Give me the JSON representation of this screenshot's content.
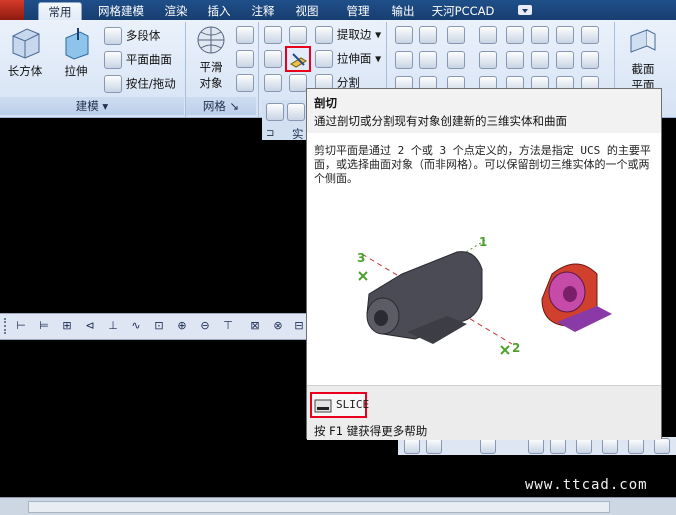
{
  "tabs": [
    "常用",
    "网格建模",
    "渲染",
    "插入",
    "注释",
    "视图",
    "管理",
    "输出",
    "天河PCCAD"
  ],
  "active_tab": "常用",
  "ribbon": {
    "modeling": {
      "box_label": "长方体",
      "extrude_label": "拉伸",
      "polysolid_label": "多段体",
      "planar_label": "平面曲面",
      "presspull_label": "按住/拖动",
      "panel_label": "建模"
    },
    "mesh": {
      "smooth_label_1": "平滑",
      "smooth_label_2": "对象",
      "panel_label": "网格"
    },
    "solid_edit": {
      "extract_edges_label": "提取边",
      "extrude_faces_label": "拉伸面",
      "separate_label": "分割",
      "panel_label": "实"
    },
    "section": {
      "label_1": "截面",
      "label_2": "平面"
    }
  },
  "tooltip": {
    "title": "剖切",
    "summary": "通过剖切或分割现有对象创建新的三维实体和曲面",
    "description": "剪切平面是通过 2 个或 3 个点定义的，方法是指定 UCS 的主要平面，或选择曲面对象（而非网格）。可以保留剖切三维实体的一个或两个侧面。",
    "illus_labels": [
      "3",
      "1",
      "2"
    ],
    "command": "SLICE",
    "help": "按 F1 键获得更多帮助"
  },
  "watermark": "www.ttcad.com",
  "colors": {
    "tab_bar": "#1f4f8a",
    "ribbon_bg": "#dde8f6",
    "highlight": "#e8001c",
    "canvas": "#000000"
  }
}
